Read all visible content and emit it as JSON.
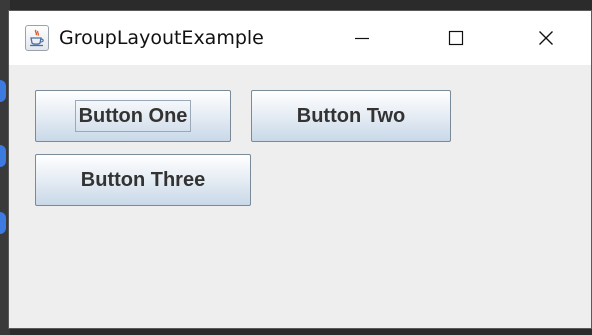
{
  "window": {
    "title": "GroupLayoutExample",
    "app_icon": "java-cup-icon",
    "controls": {
      "minimize_icon": "minimize-icon",
      "maximize_icon": "maximize-icon",
      "close_icon": "close-icon"
    }
  },
  "buttons": {
    "one": "Button One",
    "two": "Button Two",
    "three": "Button Three"
  },
  "colors": {
    "titlebar": "#ffffff",
    "content_bg": "#eeeeee",
    "button_gradient_top": "#ffffff",
    "button_gradient_bottom": "#c9d8e8",
    "button_border": "#7a8a99",
    "button_text": "#333333"
  }
}
